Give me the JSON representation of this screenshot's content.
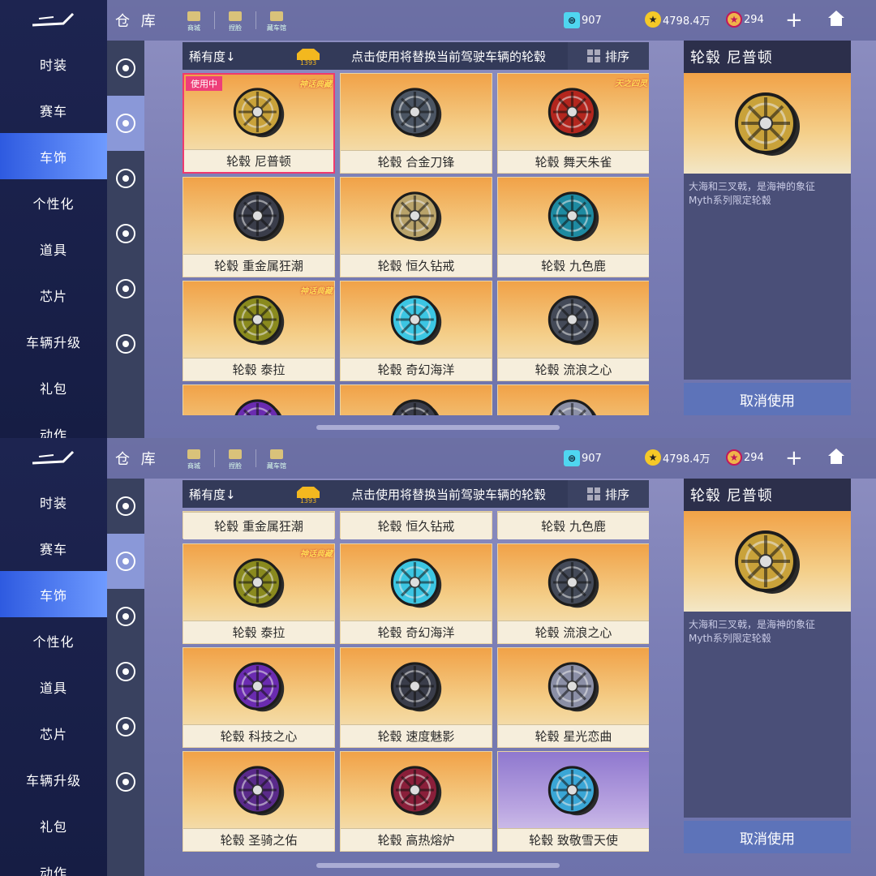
{
  "panels": [
    {
      "header": {
        "title": "仓 库",
        "links": [
          "商城",
          "捏脸",
          "藏车馆"
        ],
        "tickets": "907",
        "coins": "4798.4万",
        "points": "294"
      },
      "sidebar": {
        "items": [
          "时装",
          "赛车",
          "车饰",
          "个性化",
          "道具",
          "芯片",
          "车辆升级",
          "礼包",
          "动作"
        ],
        "active_index": 2
      },
      "filter": {
        "rarity": "稀有度↓",
        "badge": "1393",
        "hint": "点击使用将替换当前驾驶车辆的轮毂",
        "sort": "排序"
      },
      "cards": [
        {
          "label": "轮毂 尼普顿",
          "selected": true,
          "tag": "使用中",
          "corner": "神话典藏",
          "color": "#c9a23a"
        },
        {
          "label": "轮毂 合金刀锋",
          "color": "#4b5563"
        },
        {
          "label": "轮毂 舞天朱雀",
          "corner": "天之四灵",
          "color": "#b3261e"
        },
        {
          "label": "轮毂 重金属狂潮",
          "color": "#3a3d4a"
        },
        {
          "label": "轮毂 恒久钻戒",
          "color": "#b9a36a"
        },
        {
          "label": "轮毂 九色鹿",
          "color": "#1e8aa1"
        },
        {
          "label": "轮毂 泰拉",
          "corner": "神话典藏",
          "color": "#8a8a1e"
        },
        {
          "label": "轮毂 奇幻海洋",
          "color": "#3cc6e3"
        },
        {
          "label": "轮毂 流浪之心",
          "color": "#444a58"
        }
      ],
      "detail": {
        "name": "轮毂 尼普顿",
        "desc": "大海和三叉戟，是海神的象征\nMyth系列限定轮毂",
        "cancel": "取消使用"
      }
    },
    {
      "header": {
        "title": "仓 库",
        "links": [
          "商城",
          "捏脸",
          "藏车馆"
        ],
        "tickets": "907",
        "coins": "4798.4万",
        "points": "294"
      },
      "sidebar": {
        "items": [
          "时装",
          "赛车",
          "车饰",
          "个性化",
          "道具",
          "芯片",
          "车辆升级",
          "礼包",
          "动作"
        ],
        "active_index": 2
      },
      "filter": {
        "rarity": "稀有度↓",
        "badge": "1393",
        "hint": "点击使用将替换当前驾驶车辆的轮毂",
        "sort": "排序"
      },
      "partial_row": [
        "轮毂 重金属狂潮",
        "轮毂 恒久钻戒",
        "轮毂 九色鹿"
      ],
      "cards": [
        {
          "label": "轮毂 泰拉",
          "corner": "神话典藏",
          "color": "#8a8a1e"
        },
        {
          "label": "轮毂 奇幻海洋",
          "color": "#3cc6e3"
        },
        {
          "label": "轮毂 流浪之心",
          "color": "#444a58"
        },
        {
          "label": "轮毂 科技之心",
          "color": "#6a2bb0"
        },
        {
          "label": "轮毂 速度魅影",
          "color": "#3a3d4a"
        },
        {
          "label": "轮毂 星光恋曲",
          "color": "#8b8fa6"
        },
        {
          "label": "轮毂 圣骑之佑",
          "color": "#5a2a8a"
        },
        {
          "label": "轮毂 高热熔炉",
          "color": "#8a1f3a"
        },
        {
          "label": "轮毂 致敬雪天使",
          "color": "#3aa6d6",
          "purple": true
        }
      ],
      "detail": {
        "name": "轮毂 尼普顿",
        "desc": "大海和三叉戟，是海神的象征\nMyth系列限定轮毂",
        "cancel": "取消使用"
      }
    }
  ]
}
